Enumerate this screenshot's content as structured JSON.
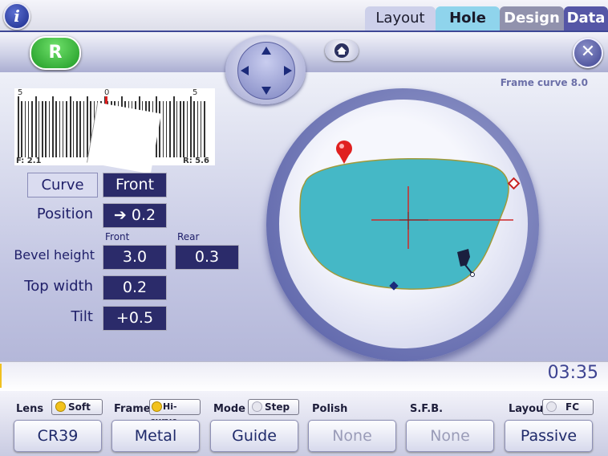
{
  "tabs": [
    {
      "label": "Layout"
    },
    {
      "label": "Hole"
    },
    {
      "label": "Design"
    },
    {
      "label": "Data"
    }
  ],
  "header": {
    "eye_label": "R"
  },
  "info_icon": "i",
  "close_icon": "✕",
  "frame_curve": "Frame curve  8.0",
  "gauge": {
    "scale_left": "5",
    "scale_center": "0",
    "scale_right": "5",
    "front_reading": "F: 2.1",
    "rear_reading": "R: 5.6"
  },
  "controls": {
    "curve_label": "Curve",
    "curve_value": "Front",
    "position_label": "Position",
    "position_value": "➔ 0.2",
    "front_label": "Front",
    "rear_label": "Rear",
    "bevel_label": "Bevel height",
    "bevel_front": "3.0",
    "bevel_rear": "0.3",
    "topwidth_label": "Top width",
    "topwidth_value": "0.2",
    "tilt_label": "Tilt",
    "tilt_value": "+0.5"
  },
  "time": "03:35",
  "bottom": {
    "lens_label": "Lens",
    "lens_toggle": "Soft",
    "lens_value": "CR39",
    "frame_label": "Frame",
    "frame_toggle": "Hi-curve",
    "frame_value": "Metal",
    "mode_label": "Mode",
    "mode_toggle": "Step",
    "mode_value": "Guide",
    "polish_label": "Polish",
    "polish_value": "None",
    "sfb_label": "S.F.B.",
    "sfb_value": "None",
    "layout_label": "Layout",
    "layout_toggle": "FC",
    "layout_value": "Passive"
  },
  "colors": {
    "lens_fill": "#45b8c6",
    "toggle_on": "#f2c21c",
    "marker_red": "#e02020",
    "accent": "#2b2b6a"
  }
}
